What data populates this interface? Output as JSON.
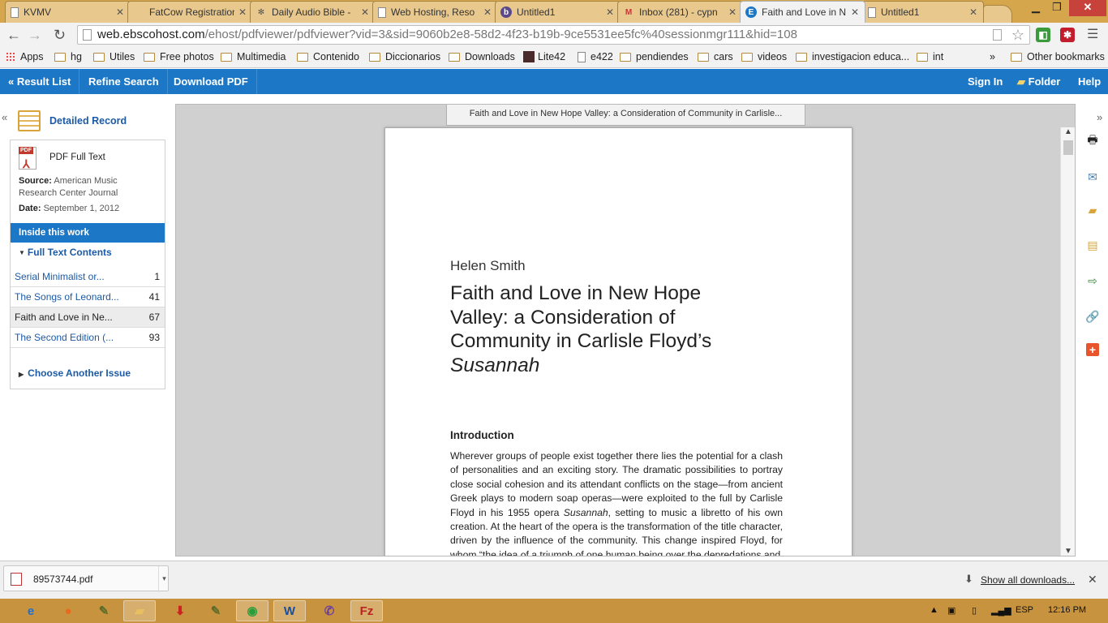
{
  "browser": {
    "tabs": [
      {
        "title": "KVMV",
        "icon": "page-icon",
        "active": false
      },
      {
        "title": "FatCow Registration",
        "icon": "page-icon",
        "active": false
      },
      {
        "title": "Daily Audio Bible -",
        "icon": "dab-icon",
        "active": false
      },
      {
        "title": "Web Hosting, Reso",
        "icon": "page-icon",
        "active": false
      },
      {
        "title": "Untitled1",
        "icon": "b-icon",
        "active": false
      },
      {
        "title": "Inbox (281) - cypn",
        "icon": "gmail-icon",
        "active": false
      },
      {
        "title": "Faith and Love in N",
        "icon": "ebsco-icon",
        "active": true
      },
      {
        "title": "Untitled1",
        "icon": "page-icon",
        "active": false
      }
    ],
    "address": {
      "host": "web.ebscohost.com",
      "path": "/ehost/pdfviewer/pdfviewer?vid=3&sid=9060b2e8-58d2-4f23-b19b-9ce5531ee5fc%40sessionmgr111&hid=108"
    },
    "bookmarks": [
      "Apps",
      "hg",
      "Utiles",
      "Free photos",
      "Multimedia",
      "Contenido",
      "Diccionarios",
      "Downloads",
      "Lite42",
      "e422",
      "pendiendes",
      "cars",
      "videos",
      "investigacion educa...",
      "int"
    ],
    "bookmarks_overflow": "»",
    "other_bookmarks": "Other bookmarks"
  },
  "ebsco": {
    "result_list": "« Result List",
    "refine_search": "Refine Search",
    "download_pdf": "Download PDF",
    "sign_in": "Sign In",
    "folder": "Folder",
    "help": "Help"
  },
  "sidebar": {
    "detailed_record": "Detailed Record",
    "pdf_full_text": "PDF Full Text",
    "source_label": "Source:",
    "source_value": "American Music Research Center Journal",
    "date_label": "Date:",
    "date_value": "September 1, 2012",
    "inside": "Inside this work",
    "full_text_contents": "Full Text Contents",
    "toc": [
      {
        "title": "Serial Minimalist or...",
        "page": "1",
        "current": false
      },
      {
        "title": "The Songs of Leonard...",
        "page": "41",
        "current": false
      },
      {
        "title": "Faith and Love in Ne...",
        "page": "67",
        "current": true
      },
      {
        "title": "The Second Edition (...",
        "page": "93",
        "current": false
      }
    ],
    "choose_issue": "Choose Another Issue"
  },
  "viewer": {
    "doc_title": "Faith and Love in New Hope Valley: a Consideration of Community in Carlisle...",
    "author": "Helen Smith",
    "title_main": "Faith and Love in New Hope Valley: a Consideration of Community in Carlisle Floyd’s",
    "title_italic": "Susannah",
    "intro_heading": "Introduction",
    "body_1": "Wherever groups of people exist together there lies the potential for a clash of personalities and an exciting story. The dramatic possibilities to portray close social cohesion and its attendant conflicts on the stage—from ancient Greek plays to modern soap operas—were exploited to the full by Carlisle Floyd in his 1955 opera ",
    "body_italic": "Susannah",
    "body_2": ", setting to music a libretto of his own creation. At the heart of the opera is the transformation of the title character, driven by the influence of the community. This change inspired Floyd, for whom “the idea of a triumph of one human being over the depredations and"
  },
  "downloads": {
    "file": "89573744.pdf",
    "show_all": "Show all downloads..."
  },
  "taskbar": {
    "lang": "ESP",
    "time": "12:16 PM"
  },
  "colors": {
    "ebsco_blue": "#1c77c6",
    "link_blue": "#1c5aa6",
    "tabstrip": "#d5a64c",
    "taskbar": "#c8933e"
  }
}
